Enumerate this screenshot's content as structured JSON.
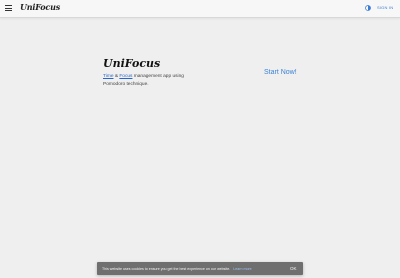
{
  "appbar": {
    "menu_icon": "menu-icon",
    "brand": "UniFocus",
    "theme_icon": "half-circle-theme-icon",
    "signin_label": "SIGN IN"
  },
  "hero": {
    "title": "UniFocus",
    "link_time": "Time",
    "amp": " & ",
    "link_focus": "Focus",
    "desc_rest": " management app using Pomodoro technique.",
    "cta": "Start Now!"
  },
  "cookie": {
    "text": "This website uses cookies to ensure you get the best experience on our website.",
    "link": "Learn more",
    "button": "OK"
  },
  "colors": {
    "background": "#efefef",
    "accent": "#3b82d6",
    "cookie_bg": "#6f6f6f"
  }
}
